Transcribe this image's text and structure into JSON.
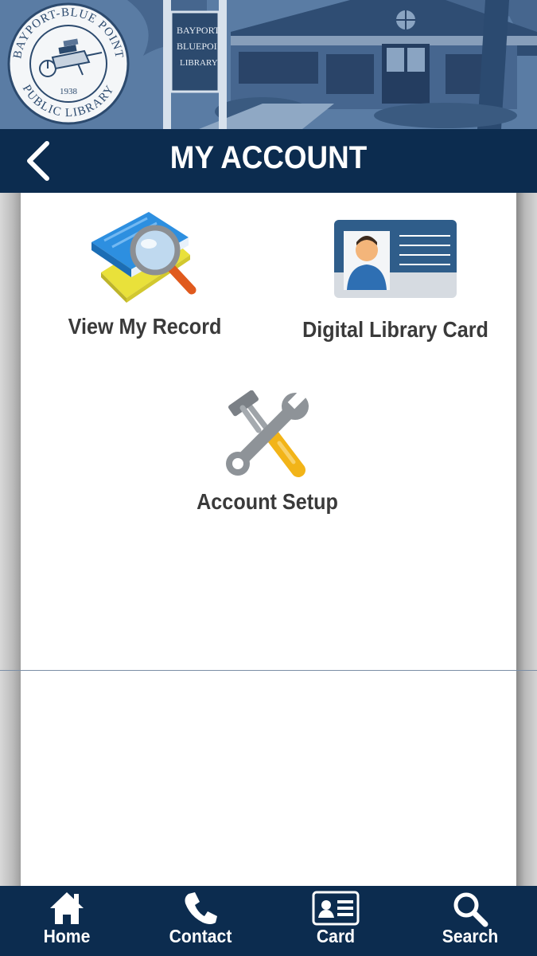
{
  "banner": {
    "logo_text_top": "BAYPORT-BLUE POINT",
    "logo_text_bottom": "PUBLIC LIBRARY",
    "logo_year": "1938",
    "sign_lines": [
      "BAYPORT",
      "BLUE POINT",
      "LIBRARY"
    ]
  },
  "header": {
    "title": "MY ACCOUNT",
    "back_icon": "chevron-left-icon"
  },
  "tiles": {
    "view_record": {
      "label": "View My Record",
      "icon": "book-magnifier-icon"
    },
    "digital_card": {
      "label": "Digital Library Card",
      "icon": "id-card-icon"
    },
    "account_setup": {
      "label": "Account Setup",
      "icon": "tools-icon"
    }
  },
  "bottom_nav": {
    "items": [
      {
        "label": "Home",
        "icon": "home-icon"
      },
      {
        "label": "Contact",
        "icon": "phone-icon"
      },
      {
        "label": "Card",
        "icon": "card-icon"
      },
      {
        "label": "Search",
        "icon": "search-icon"
      }
    ]
  },
  "colors": {
    "navy": "#0c2c4f",
    "content_bg": "#ffffff",
    "label_text": "#3a3a3a"
  }
}
